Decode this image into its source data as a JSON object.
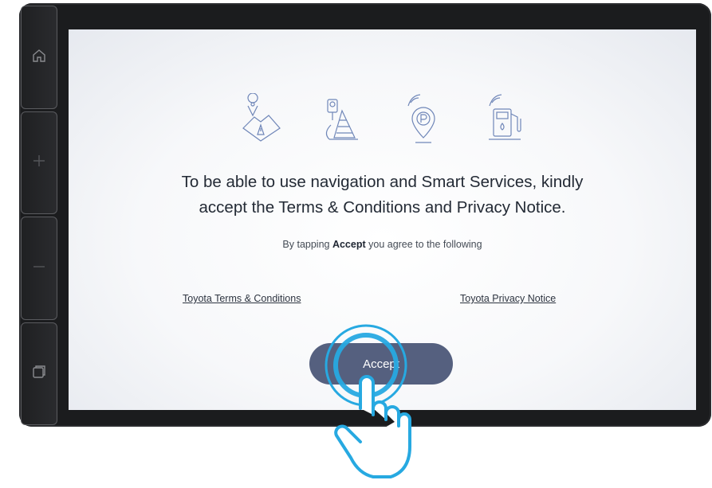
{
  "side_rail": {
    "buttons": [
      {
        "name": "home",
        "icon": "home-icon"
      },
      {
        "name": "zoom-in",
        "icon": "plus-icon"
      },
      {
        "name": "zoom-out",
        "icon": "minus-icon"
      },
      {
        "name": "window",
        "icon": "window-icon"
      }
    ]
  },
  "illustrations": [
    "map-pin-road-icon",
    "traffic-cone-camera-icon",
    "parking-pin-icon",
    "fuel-station-icon"
  ],
  "headline_line1": "To be able to use navigation and Smart Services, kindly",
  "headline_line2": "accept the Terms & Conditions and Privacy Notice.",
  "sub_prefix": "By tapping ",
  "sub_bold": "Accept",
  "sub_suffix": " you agree to the following",
  "links": {
    "terms": "Toyota Terms & Conditions",
    "privacy": "Toyota Privacy Notice"
  },
  "accept_label": "Accept",
  "colors": {
    "accent_button": "#55607f",
    "tap_indicator": "#27a9e1",
    "bezel": "#1b1c1e"
  }
}
